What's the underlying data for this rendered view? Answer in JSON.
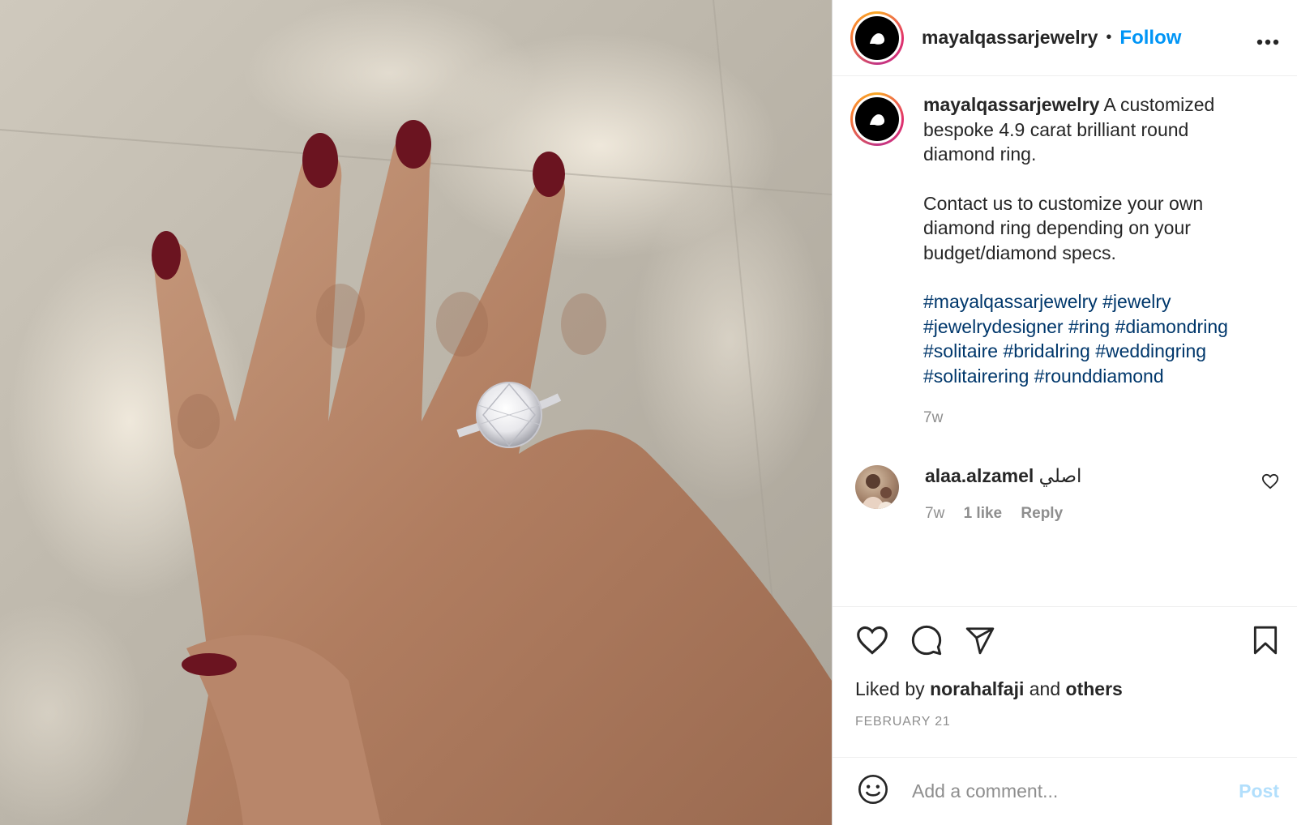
{
  "header": {
    "username": "mayalqassarjewelry",
    "separator": "•",
    "follow_label": "Follow",
    "more_label": "•••"
  },
  "avatar_logo_text": "م",
  "caption": {
    "username": "mayalqassarjewelry",
    "text_line1": "A customized bespoke 4.9 carat brilliant round diamond ring.",
    "text_line2": "Contact us to customize your own diamond ring depending on your budget/diamond specs.",
    "hashtags": [
      "#mayalqassarjewelry",
      "#jewelry",
      "#jewelrydesigner",
      "#ring",
      "#diamondring",
      "#solitaire",
      "#bridalring",
      "#weddingring",
      "#solitairering",
      "#rounddiamond"
    ],
    "time": "7w"
  },
  "comments": [
    {
      "username": "alaa.alzamel",
      "text": "اصلي",
      "time": "7w",
      "likes": "1 like",
      "reply_label": "Reply"
    }
  ],
  "likes": {
    "prefix": "Liked by",
    "user": "norahalfaji",
    "and": "and",
    "others": "others"
  },
  "date": "FEBRUARY 21",
  "comment_box": {
    "placeholder": "Add a comment...",
    "post_label": "Post"
  },
  "icons": {
    "like": "heart-icon",
    "comment": "comment-icon",
    "share": "paper-plane-icon",
    "save": "bookmark-icon",
    "emoji": "emoji-icon",
    "comment_like": "small-heart-icon"
  },
  "colors": {
    "follow": "#0095f6",
    "hashtag": "#00376b",
    "muted": "#8e8e8e",
    "post_disabled": "#b2dffc",
    "nail_polish": "#6b1420",
    "skin": "#b8866a"
  }
}
